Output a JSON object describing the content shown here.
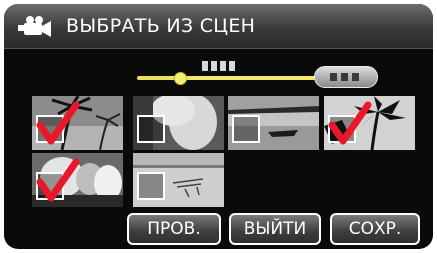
{
  "header": {
    "title": "ВЫБРАТЬ ИЗ СЦЕН",
    "icon": "video-camera-icon"
  },
  "slider": {
    "position_fraction": 0.2,
    "label_icon": "dotted-label-icon",
    "pill_icon": "dotted-pill-icon"
  },
  "scenes": [
    {
      "name": "scene-palm-beach",
      "checked": true
    },
    {
      "name": "scene-person-portrait",
      "checked": false
    },
    {
      "name": "scene-boat-lake",
      "checked": false
    },
    {
      "name": "scene-palm-silhouette",
      "checked": true
    },
    {
      "name": "scene-group-people",
      "checked": true
    },
    {
      "name": "scene-beach-chairs",
      "checked": false
    }
  ],
  "buttons": {
    "check": "ПРОВ.",
    "exit": "ВЫЙТИ",
    "save": "СОХР."
  },
  "colors": {
    "accent_check": "#e8182a",
    "slider": "#f0e86a",
    "background": "#0a0a0a"
  }
}
